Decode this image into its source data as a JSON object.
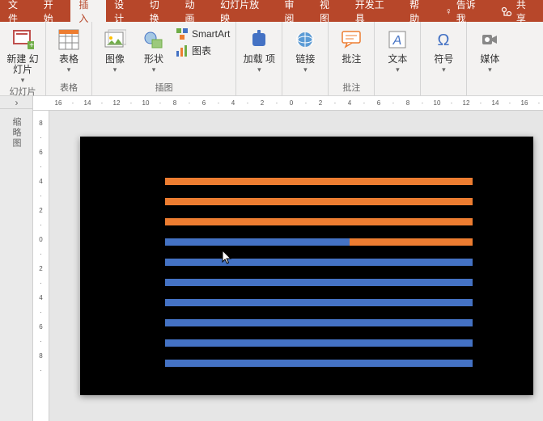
{
  "menubar": {
    "items": [
      "文件",
      "开始",
      "插入",
      "设计",
      "切换",
      "动画",
      "幻灯片放映",
      "审阅",
      "视图",
      "开发工具",
      "帮助"
    ],
    "active_index": 2,
    "tell_me": "告诉我",
    "share": "共享"
  },
  "ribbon": {
    "new_slide": "新建\n幻灯片",
    "group_slides": "幻灯片",
    "table": "表格",
    "group_table": "表格",
    "images": "图像",
    "shapes": "形状",
    "smartart": "SmartArt",
    "chart": "图表",
    "group_illus": "插图",
    "addins": "加载\n项",
    "links": "链接",
    "comment": "批注",
    "group_comment": "批注",
    "text": "文本",
    "symbol": "符号",
    "media": "媒体"
  },
  "outline": {
    "expand": "›",
    "label": "缩略图"
  },
  "ruler_h": [
    "16",
    "14",
    "12",
    "10",
    "8",
    "6",
    "4",
    "2",
    "0",
    "2",
    "4",
    "6",
    "8",
    "10",
    "12",
    "14",
    "16"
  ],
  "ruler_v": [
    "8",
    "6",
    "4",
    "2",
    "0",
    "2",
    "4",
    "6",
    "8"
  ],
  "colors": {
    "orange": "#ed7d31",
    "blue": "#4472c4"
  },
  "chart_data": {
    "type": "bar",
    "orientation": "horizontal",
    "title": "",
    "series": [
      {
        "name": "orange",
        "color": "#ed7d31"
      },
      {
        "name": "blue",
        "color": "#4472c4"
      }
    ],
    "bars": [
      {
        "segments": [
          {
            "series": "orange",
            "fraction": 1.0
          }
        ]
      },
      {
        "segments": [
          {
            "series": "orange",
            "fraction": 1.0
          }
        ]
      },
      {
        "segments": [
          {
            "series": "orange",
            "fraction": 1.0
          }
        ]
      },
      {
        "segments": [
          {
            "series": "blue",
            "fraction": 0.6
          },
          {
            "series": "orange",
            "fraction": 0.4
          }
        ]
      },
      {
        "segments": [
          {
            "series": "blue",
            "fraction": 1.0
          }
        ]
      },
      {
        "segments": [
          {
            "series": "blue",
            "fraction": 1.0
          }
        ]
      },
      {
        "segments": [
          {
            "series": "blue",
            "fraction": 1.0
          }
        ]
      },
      {
        "segments": [
          {
            "series": "blue",
            "fraction": 1.0
          }
        ]
      },
      {
        "segments": [
          {
            "series": "blue",
            "fraction": 1.0
          }
        ]
      },
      {
        "segments": [
          {
            "series": "blue",
            "fraction": 1.0
          }
        ]
      }
    ]
  }
}
